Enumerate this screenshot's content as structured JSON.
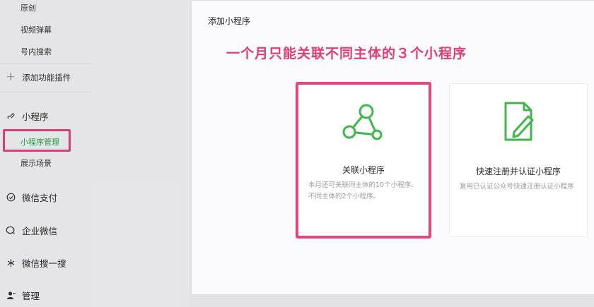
{
  "sidebar": {
    "sub_items_top": [
      "原创",
      "视频弹幕",
      "号内搜索"
    ],
    "add_plugin": "添加功能插件",
    "mini_program": {
      "label": "小程序",
      "children": [
        "小程序管理",
        "展示场景"
      ]
    },
    "sections": [
      {
        "label": "微信支付",
        "icon": "check-circle-icon"
      },
      {
        "label": "企业微信",
        "icon": "chat-bubble-icon"
      },
      {
        "label": "微信搜一搜",
        "icon": "sparkle-icon"
      },
      {
        "label": "管理",
        "icon": "person-icon"
      }
    ]
  },
  "dialog": {
    "title": "添加小程序",
    "annotation": "一个月只能关联不同主体的３个小程序",
    "cards": [
      {
        "title": "关联小程序",
        "description": "本月还可关联同主体的10个小程序、不同主体的2个小程序。",
        "icon": "link-nodes-icon"
      },
      {
        "title": "快速注册并认证小程序",
        "description": "复用已认证公众号快速注册认证小程序",
        "icon": "edit-document-icon"
      }
    ]
  },
  "colors": {
    "accent_green": "#27a24a",
    "highlight_pink": "#e2467c",
    "annotation_pink": "#e03c73"
  }
}
